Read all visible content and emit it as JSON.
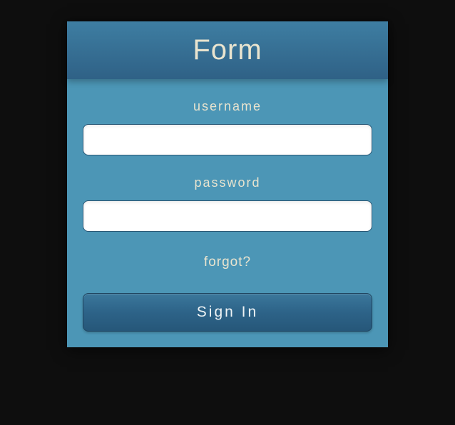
{
  "form": {
    "title": "Form",
    "username_label": "username",
    "username_value": "",
    "password_label": "password",
    "password_value": "",
    "forgot_label": "forgot?",
    "signin_label": "Sign In"
  }
}
